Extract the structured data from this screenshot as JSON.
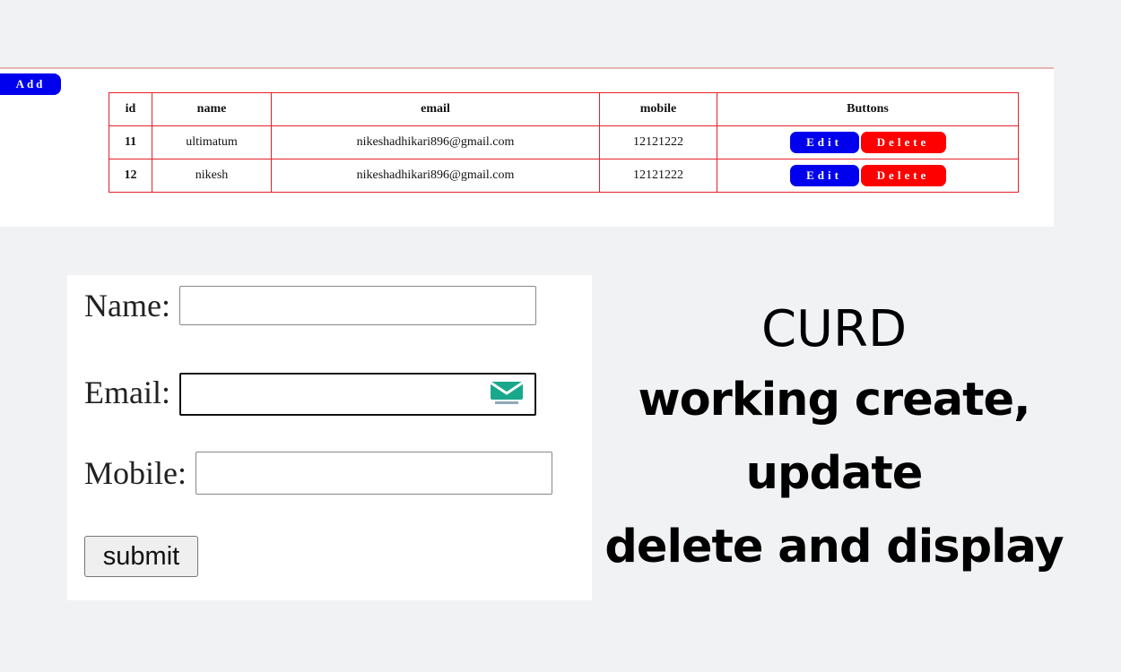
{
  "toolbar": {
    "add_label": "Add"
  },
  "table": {
    "headers": [
      "id",
      "name",
      "email",
      "mobile",
      "Buttons"
    ],
    "rows": [
      {
        "id": "11",
        "name": "ultimatum",
        "email": "nikeshadhikari896@gmail.com",
        "mobile": "12121222",
        "edit_label": "Edit",
        "delete_label": "Delete"
      },
      {
        "id": "12",
        "name": "nikesh",
        "email": "nikeshadhikari896@gmail.com",
        "mobile": "12121222",
        "edit_label": "Edit",
        "delete_label": "Delete"
      }
    ]
  },
  "form": {
    "name_label": "Name:",
    "email_label": "Email:",
    "mobile_label": "Mobile:",
    "name_value": "",
    "email_value": "",
    "mobile_value": "",
    "submit_label": "submit",
    "email_icon": "mail-icon"
  },
  "headline": {
    "title": "CURD",
    "line1": "working create,",
    "line2": "update",
    "line3": "delete and display"
  },
  "colors": {
    "edit": "#0000ee",
    "delete": "#ff0000",
    "table_border": "#e8202a",
    "background": "#f1f2f4"
  }
}
